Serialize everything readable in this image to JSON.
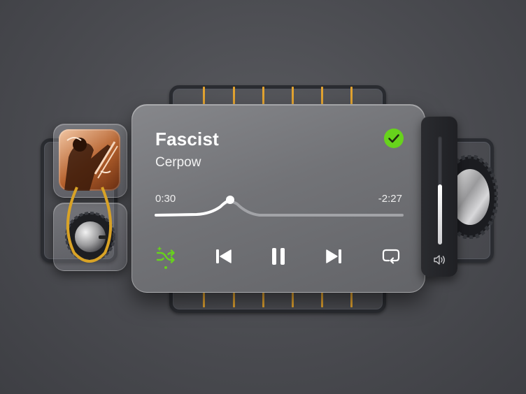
{
  "track": {
    "title": "Fascist",
    "artist": "Cerpow",
    "elapsed": "0:30",
    "remaining": "-2:27",
    "progress": 0.18,
    "liked": true
  },
  "controls": {
    "shuffle_icon": "shuffle-icon",
    "shuffle_active": true,
    "previous_icon": "skip-back-icon",
    "play_pause_icon": "pause-icon",
    "next_icon": "skip-forward-icon",
    "repeat_icon": "repeat-icon"
  },
  "volume": {
    "level": 0.55,
    "icon": "speaker-icon"
  },
  "colors": {
    "accent_green": "#67d31c",
    "rail_accent": "#e3a431",
    "belt": "#d9a326"
  }
}
